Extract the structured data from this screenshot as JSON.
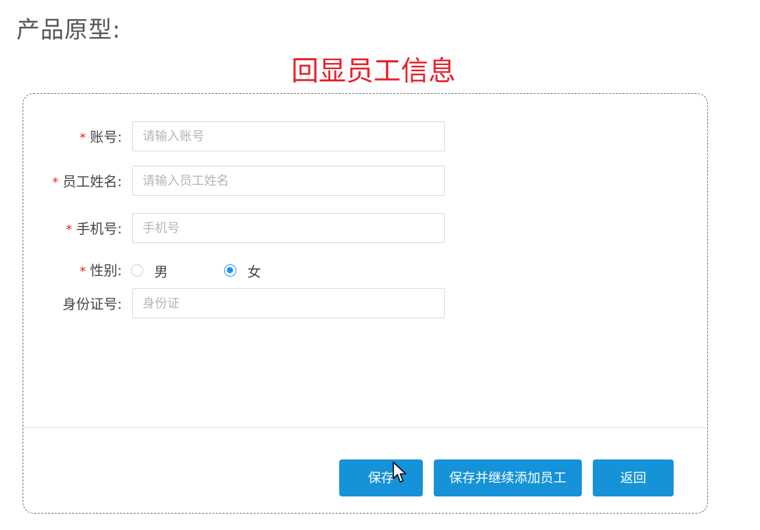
{
  "page": {
    "title": "产品原型:",
    "heading": "回显员工信息"
  },
  "form": {
    "account": {
      "label": "账号:",
      "required": true,
      "placeholder": "请输入账号",
      "value": ""
    },
    "name": {
      "label": "员工姓名:",
      "required": true,
      "placeholder": "请输入员工姓名",
      "value": ""
    },
    "phone": {
      "label": "手机号:",
      "required": true,
      "placeholder": "手机号",
      "value": ""
    },
    "gender": {
      "label": "性别:",
      "required": true,
      "options": [
        "男",
        "女"
      ],
      "selected": "女"
    },
    "id_card": {
      "label": "身份证号:",
      "required": false,
      "placeholder": "身份证",
      "value": ""
    },
    "required_mark": "*"
  },
  "actions": {
    "save_label": "保存",
    "save_continue_label": "保存并继续添加员工",
    "back_label": "返回"
  },
  "colors": {
    "accent": "#1592d8",
    "radio": "#1890ff",
    "heading": "#e6212a",
    "required": "#e6212a"
  },
  "icons": {
    "cursor": "mouse-pointer-icon"
  }
}
